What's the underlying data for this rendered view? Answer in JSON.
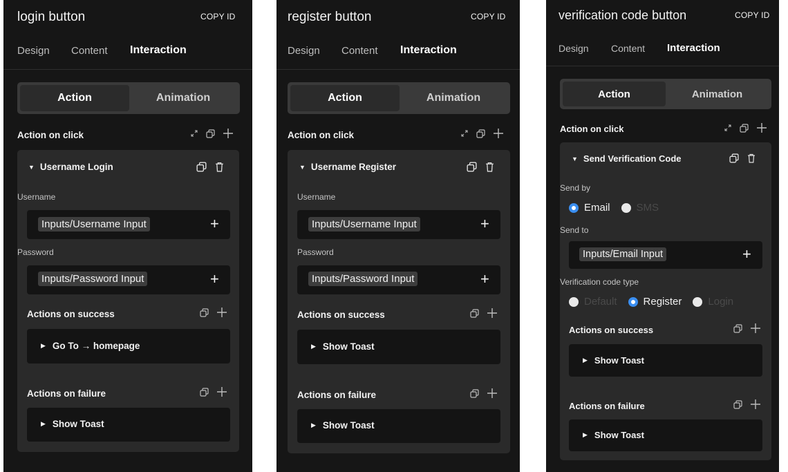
{
  "tab_labels": {
    "design": "Design",
    "content": "Content",
    "interaction": "Interaction"
  },
  "seg_labels": {
    "action": "Action",
    "animation": "Animation"
  },
  "copy_id": "COPY ID",
  "panels": [
    {
      "title": "login button",
      "action_on_click": "Action on click",
      "card_title": "Username Login",
      "username_label": "Username",
      "username_value": "Inputs/Username Input",
      "password_label": "Password",
      "password_value": "Inputs/Password Input",
      "success_label": "Actions on success",
      "success_action": "Go To → homepage",
      "failure_label": "Actions on failure",
      "failure_action": "Show Toast"
    },
    {
      "title": "register button",
      "action_on_click": "Action on click",
      "card_title": "Username Register",
      "username_label": "Username",
      "username_value": "Inputs/Username Input",
      "password_label": "Password",
      "password_value": "Inputs/Password Input",
      "success_label": "Actions on success",
      "success_action": "Show Toast",
      "failure_label": "Actions on failure",
      "failure_action": "Show Toast"
    },
    {
      "title": "verification code button",
      "action_on_click": "Action on click",
      "card_title": "Send Verification Code",
      "send_by_label": "Send by",
      "send_by_options": [
        {
          "label": "Email",
          "selected": true
        },
        {
          "label": "SMS",
          "selected": false
        }
      ],
      "send_to_label": "Send to",
      "send_to_value": "Inputs/Email Input",
      "code_type_label": "Verification code type",
      "code_type_options": [
        {
          "label": "Default",
          "selected": false
        },
        {
          "label": "Register",
          "selected": true
        },
        {
          "label": "Login",
          "selected": false
        }
      ],
      "success_label": "Actions on success",
      "success_action": "Show Toast",
      "failure_label": "Actions on failure",
      "failure_action": "Show Toast"
    }
  ],
  "icons": {
    "expand": "expand-icon",
    "copy": "copy-icon",
    "add": "plus-icon",
    "delete": "trash-icon",
    "collapse": "caret-down-icon",
    "expand_row": "caret-right-icon"
  },
  "colors": {
    "panel_bg": "#161616",
    "card_bg": "#2a2a2a",
    "field_bg": "#141414",
    "accent": "#3a8ef0"
  }
}
